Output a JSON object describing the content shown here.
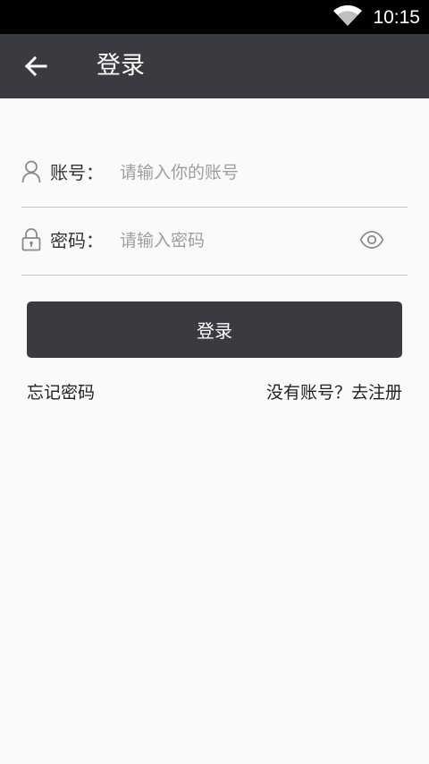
{
  "status_bar": {
    "time": "10:15",
    "wifi_icon": "wifi-icon"
  },
  "app_bar": {
    "back_icon": "arrow-left-icon",
    "title": "登录"
  },
  "form": {
    "account": {
      "icon": "user-icon",
      "label": "账号：",
      "value": "",
      "placeholder": "请输入你的账号"
    },
    "password": {
      "icon": "lock-icon",
      "label": "密码：",
      "value": "",
      "placeholder": "请输入密码",
      "toggle_icon": "eye-icon"
    },
    "submit_label": "登录"
  },
  "links": {
    "forgot_password": "忘记密码",
    "register": "没有账号？去注册"
  },
  "colors": {
    "status_bar": "#000000",
    "app_bar": "#3a3b40",
    "background": "#fafafa",
    "button": "#3a3b40",
    "divider": "#c2c2c2",
    "placeholder": "#9e9e9e"
  }
}
